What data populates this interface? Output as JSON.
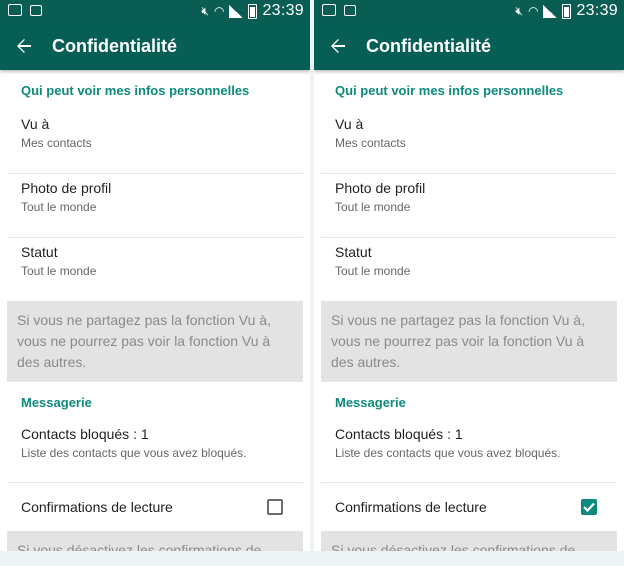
{
  "status_bar": {
    "time": "23:39",
    "notification_icons": [
      "voicemail-icon",
      "image-icon"
    ],
    "system_icons": [
      "mute-icon",
      "wifi-icon",
      "signal-icon",
      "battery-icon"
    ]
  },
  "screens": [
    {
      "app_bar": {
        "title": "Confidentialité"
      },
      "section_personal": "Qui peut voir mes infos personnelles",
      "items": [
        {
          "label": "Vu à",
          "value": "Mes contacts"
        },
        {
          "label": "Photo de profil",
          "value": "Tout le monde"
        },
        {
          "label": "Statut",
          "value": "Tout le monde"
        }
      ],
      "note_last_seen": "Si vous ne partagez pas la fonction Vu à, vous ne pourrez pas voir la fonction Vu à des autres.",
      "section_messaging": "Messagerie",
      "blocked": {
        "label": "Contacts bloqués : 1",
        "value": "Liste des contacts que vous avez bloqués."
      },
      "read_receipts": {
        "label": "Confirmations de lecture",
        "checked": false
      },
      "note_read_receipts": "Si vous désactivez les confirmations de"
    },
    {
      "app_bar": {
        "title": "Confidentialité"
      },
      "section_personal": "Qui peut voir mes infos personnelles",
      "items": [
        {
          "label": "Vu à",
          "value": "Mes contacts"
        },
        {
          "label": "Photo de profil",
          "value": "Tout le monde"
        },
        {
          "label": "Statut",
          "value": "Tout le monde"
        }
      ],
      "note_last_seen": "Si vous ne partagez pas la fonction Vu à, vous ne pourrez pas voir la fonction Vu à des autres.",
      "section_messaging": "Messagerie",
      "blocked": {
        "label": "Contacts bloqués : 1",
        "value": "Liste des contacts que vous avez bloqués."
      },
      "read_receipts": {
        "label": "Confirmations de lecture",
        "checked": true
      },
      "note_read_receipts": "Si vous désactivez les confirmations de"
    }
  ],
  "colors": {
    "app_bar": "#075e54",
    "status_bar": "#0a5d53",
    "accent": "#0d8a7c",
    "note_bg": "#e3e3e3"
  }
}
